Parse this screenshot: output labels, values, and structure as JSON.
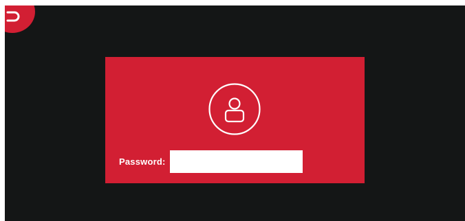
{
  "login": {
    "password_label": "Password:",
    "password_value": "",
    "password_placeholder": ""
  },
  "icons": {
    "corner_logo": "brand-logo-icon",
    "avatar": "user-avatar-icon"
  },
  "colors": {
    "background": "#141616",
    "accent": "#d21f33",
    "input_background": "#ffffff",
    "text": "#ffffff"
  }
}
